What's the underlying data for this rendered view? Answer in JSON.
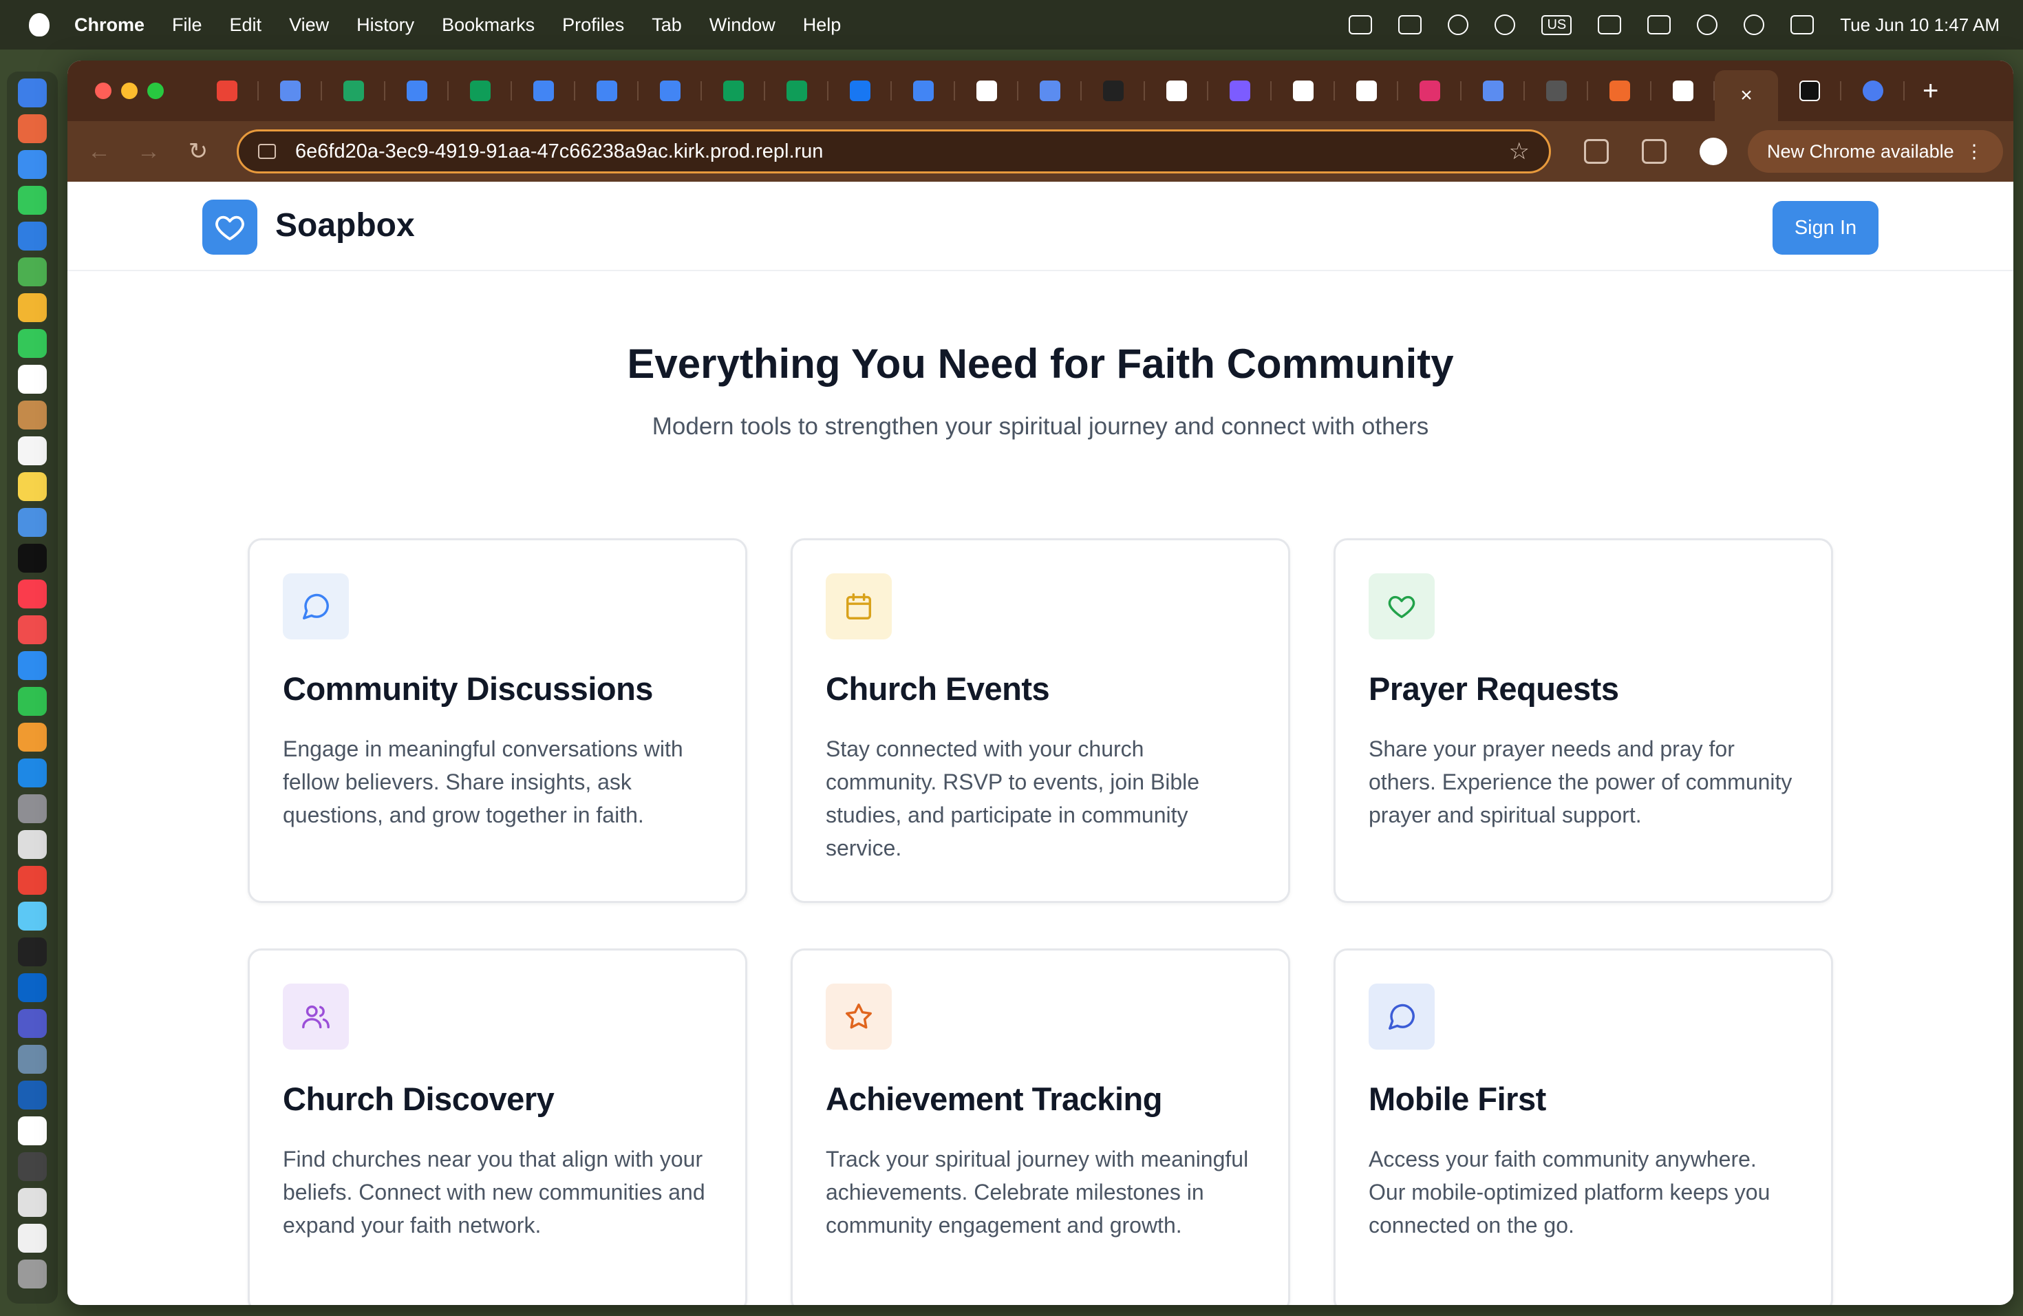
{
  "menubar": {
    "app_name": "Chrome",
    "items": [
      "File",
      "Edit",
      "View",
      "History",
      "Bookmarks",
      "Profiles",
      "Tab",
      "Window",
      "Help"
    ],
    "keyboard_layout": "US",
    "clock": "Tue Jun 10  1:47 AM"
  },
  "browser": {
    "url": "6e6fd20a-3ec9-4919-91aa-47c66238a9ac.kirk.prod.repl.run",
    "update_button": "New Chrome available",
    "tab_favicons": [
      "gmail-icon",
      "notion-icon",
      "drive-icon",
      "docs-icon",
      "sheets-icon",
      "docs-icon",
      "docs-icon",
      "docs-icon",
      "sheets-icon",
      "sheets-icon",
      "facebook-icon",
      "docs-icon",
      "openai-icon",
      "notion-icon",
      "app-icon",
      "google-icon",
      "circle-icon",
      "google-icon",
      "chrome-icon",
      "instagram-icon",
      "notion-icon",
      "app-icon",
      "app-icon",
      "openai-icon"
    ],
    "tab_favicon_colors": [
      "#ea4335",
      "#5b8cf0",
      "#1fa463",
      "#4285f4",
      "#0f9d58",
      "#4285f4",
      "#4285f4",
      "#4285f4",
      "#0f9d58",
      "#0f9d58",
      "#1877f2",
      "#4285f4",
      "#ffffff",
      "#5b8cf0",
      "#222222",
      "#ffffff",
      "#7c5cff",
      "#ffffff",
      "#ffffff",
      "#e1306c",
      "#5b8cf0",
      "#555555",
      "#f06a2a",
      "#ffffff"
    ],
    "active_tab_close": "×",
    "after_tabs": [
      "x-icon",
      "openai-icon"
    ],
    "new_tab": "+"
  },
  "site": {
    "brand": "Soapbox",
    "sign_in": "Sign In",
    "hero_title": "Everything You Need for Faith Community",
    "hero_subtitle": "Modern tools to strengthen your spiritual journey and connect with others",
    "features": [
      {
        "title": "Community Discussions",
        "desc": "Engage in meaningful conversations with fellow believers. Share insights, ask questions, and grow together in faith.",
        "icon": "chat-bubble-icon",
        "bg": "#eaf1fb",
        "color": "#3b82f6"
      },
      {
        "title": "Church Events",
        "desc": "Stay connected with your church community. RSVP to events, join Bible studies, and participate in community service.",
        "icon": "calendar-icon",
        "bg": "#fdf3d6",
        "color": "#d9a21b"
      },
      {
        "title": "Prayer Requests",
        "desc": "Share your prayer needs and pray for others. Experience the power of community prayer and spiritual support.",
        "icon": "heart-icon",
        "bg": "#e6f6ea",
        "color": "#22a24a"
      },
      {
        "title": "Church Discovery",
        "desc": "Find churches near you that align with your beliefs. Connect with new communities and expand your faith network.",
        "icon": "users-icon",
        "bg": "#f1e8fb",
        "color": "#9b4fd8"
      },
      {
        "title": "Achievement Tracking",
        "desc": "Track your spiritual journey with meaningful achievements. Celebrate milestones in community engagement and growth.",
        "icon": "star-icon",
        "bg": "#fdeee2",
        "color": "#e0651e"
      },
      {
        "title": "Mobile First",
        "desc": "Access your faith community anywhere. Our mobile-optimized platform keeps you connected on the go.",
        "icon": "chat-bubble-icon",
        "bg": "#e4ecfb",
        "color": "#3b5cd6"
      }
    ]
  }
}
